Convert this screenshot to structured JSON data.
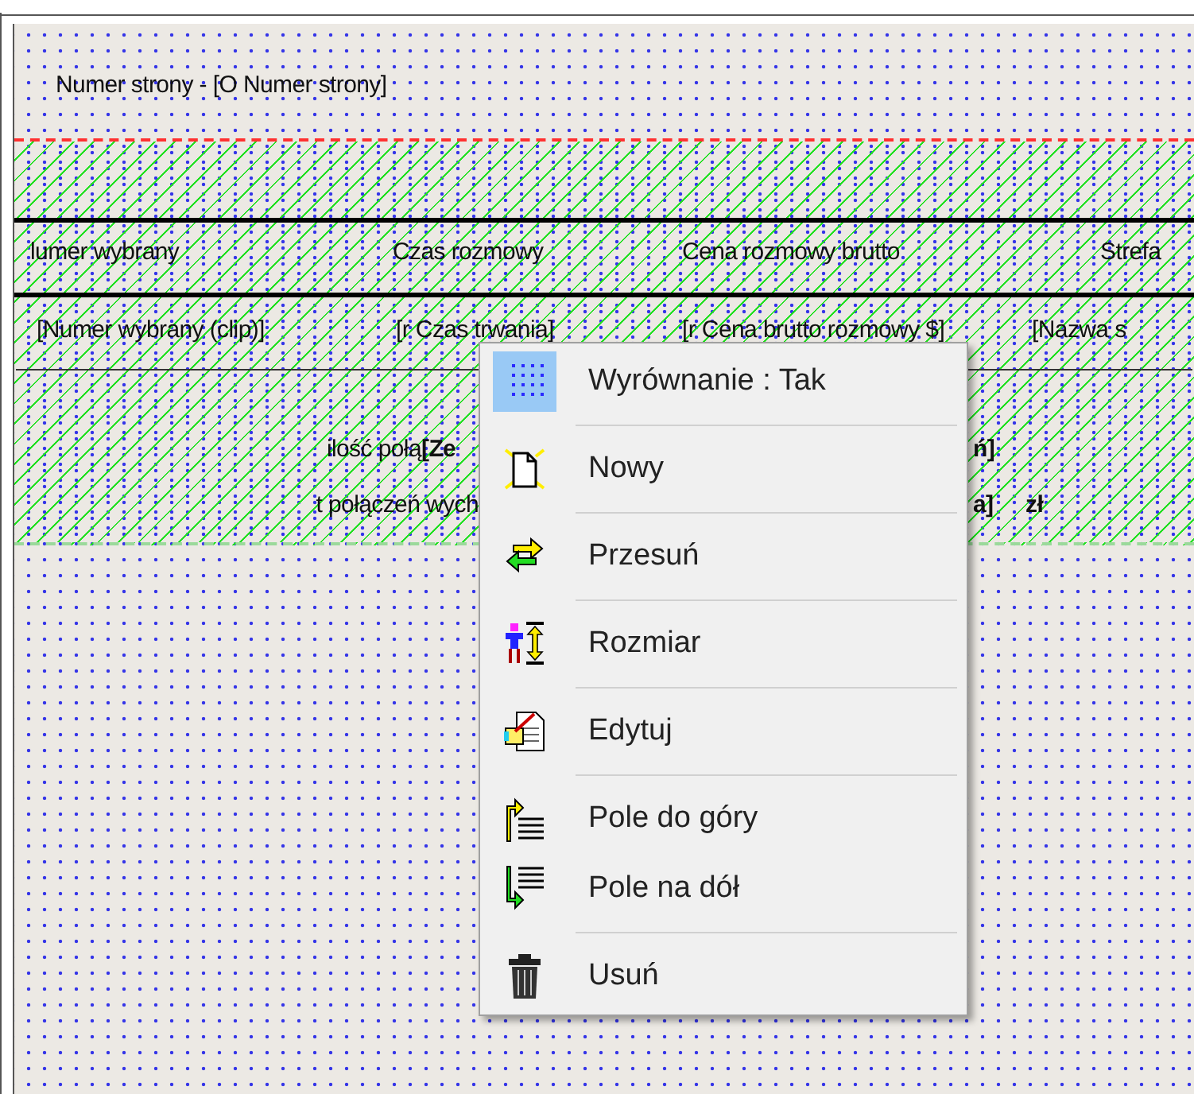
{
  "page_header": {
    "text": "Numer strony - [O Numer strony]"
  },
  "column_headers": [
    "lumer wybrany",
    "Czas rozmowy",
    "Cena rozmowy brutto",
    "Strefa"
  ],
  "detail_fields": [
    "[Numer wybrany (clip)]",
    "[r Czas trwania]",
    "[r Cena brutto rozmowy $]",
    "[Nazwa s"
  ],
  "summary_lines": [
    {
      "label": "ilość połą",
      "field_start": "[Ze",
      "field_end": "ń]"
    },
    {
      "label": "t połączeń wych",
      "field_end": "a]",
      "unit": "zł"
    }
  ],
  "context_menu": {
    "items": [
      {
        "kind": "grid",
        "label": "Wyrównanie : Tak",
        "checked": true,
        "separator_after": true
      },
      {
        "kind": "new",
        "label": "Nowy",
        "separator_after": true
      },
      {
        "kind": "move",
        "label": "Przesuń",
        "separator_after": true
      },
      {
        "kind": "resize",
        "label": "Rozmiar",
        "separator_after": true
      },
      {
        "kind": "edit",
        "label": "Edytuj",
        "separator_after": true
      },
      {
        "kind": "up",
        "label": "Pole do góry",
        "separator_after": false
      },
      {
        "kind": "down",
        "label": "Pole na dół",
        "separator_after": true
      },
      {
        "kind": "delete",
        "label": "Usuń",
        "separator_after": false
      }
    ]
  }
}
